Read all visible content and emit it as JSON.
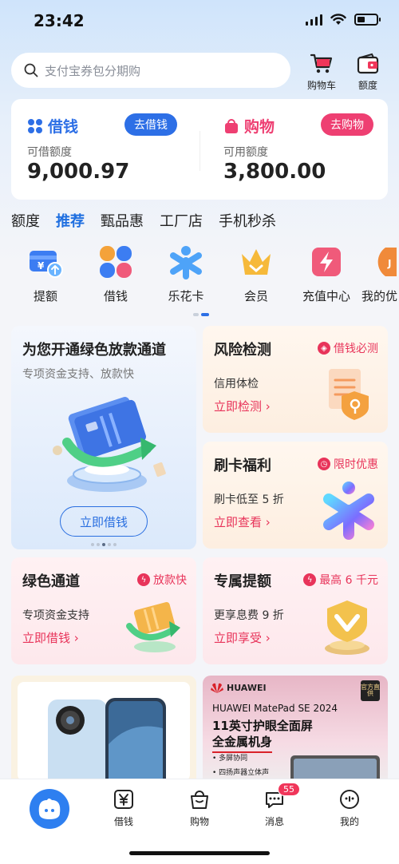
{
  "status_bar": {
    "time": "23:42"
  },
  "search": {
    "placeholder": "支付宝券包分期购"
  },
  "header_buttons": {
    "cart": "购物车",
    "quota": "额度"
  },
  "loan_card": {
    "title": "借钱",
    "button": "去借钱",
    "label": "可借额度",
    "amount": "9,000.97"
  },
  "shop_card": {
    "title": "购物",
    "button": "去购物",
    "label": "可用额度",
    "amount": "3,800.00"
  },
  "tabs": [
    {
      "label": "额度"
    },
    {
      "label": "推荐",
      "active": true
    },
    {
      "label": "甄品惠"
    },
    {
      "label": "工厂店"
    },
    {
      "label": "手机秒杀"
    }
  ],
  "icon_grid": [
    {
      "label": "提额",
      "icon": "raise-limit-icon"
    },
    {
      "label": "借钱",
      "icon": "four-petal-icon"
    },
    {
      "label": "乐花卡",
      "icon": "lehua-card-icon"
    },
    {
      "label": "会员",
      "icon": "crown-icon"
    },
    {
      "label": "充值中心",
      "icon": "recharge-icon"
    },
    {
      "label": "我的优",
      "icon": "coupon-icon"
    }
  ],
  "promo_big": {
    "title": "为您开通绿色放款通道",
    "subtitle": "专项资金支持、放款快",
    "button": "立即借钱"
  },
  "promo_risk": {
    "title": "风险检测",
    "tag": "借钱必测",
    "desc": "信用体检",
    "link": "立即检测 ›"
  },
  "promo_card": {
    "title": "刷卡福利",
    "tag": "限时优惠",
    "desc": "刷卡低至 5 折",
    "link": "立即查看 ›"
  },
  "promo_green": {
    "title": "绿色通道",
    "tag": "放款快",
    "desc": "专项资金支持",
    "link": "立即借钱 ›"
  },
  "promo_quota": {
    "title": "专属提额",
    "tag": "最高 6 千元",
    "desc": "更享息费 9 折",
    "link": "立即享受 ›"
  },
  "product_ad": {
    "brand": "HUAWEI",
    "badge": "官方直供",
    "model": "HUAWEI MatePad SE 2024",
    "headline1": "11英寸护眼全面屏",
    "headline2": "全金属机身",
    "feature1": "• 多屏协同",
    "feature2": "• 四扬声器立体声"
  },
  "bottom_nav": [
    {
      "label": "",
      "icon": "home-mascot-icon"
    },
    {
      "label": "借钱",
      "icon": "yen-icon"
    },
    {
      "label": "购物",
      "icon": "shopping-bag-icon"
    },
    {
      "label": "消息",
      "icon": "message-icon",
      "badge": "55"
    },
    {
      "label": "我的",
      "icon": "profile-icon"
    }
  ],
  "colors": {
    "accent_blue": "#1f6fe0",
    "accent_pink": "#e8345a",
    "loan_button": "#2d6fe6",
    "shop_button": "#ee3f72"
  }
}
